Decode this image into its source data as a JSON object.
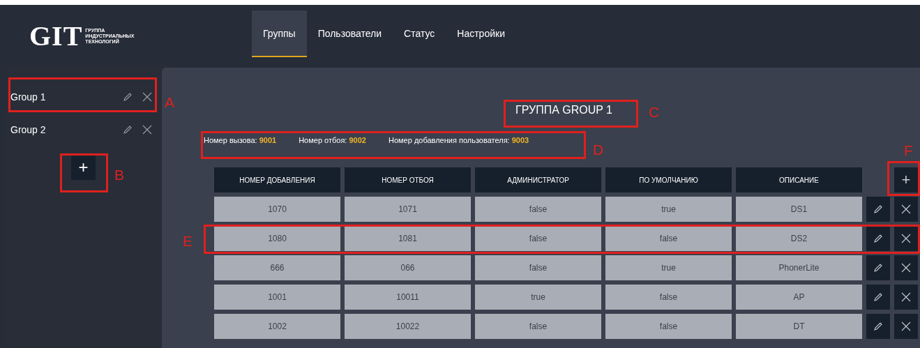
{
  "logo": {
    "mark": "GIT",
    "lines": [
      "ГРУППА",
      "ИНДУСТРИАЛЬНЫХ",
      "ТЕХНОЛОГИЙ"
    ]
  },
  "nav": [
    {
      "label": "Группы",
      "selected": true
    },
    {
      "label": "Пользователи",
      "selected": false
    },
    {
      "label": "Статус",
      "selected": false
    },
    {
      "label": "Настройки",
      "selected": false
    }
  ],
  "sidebar": {
    "groups": [
      {
        "name": "Group 1"
      },
      {
        "name": "Group 2"
      }
    ],
    "add_button": "+"
  },
  "panel": {
    "title": "ГРУППА GROUP 1",
    "info": [
      {
        "label": "Номер вызова:",
        "value": "9001"
      },
      {
        "label": "Номер отбоя:",
        "value": "9002"
      },
      {
        "label": "Номер добавления пользователя:",
        "value": "9003"
      }
    ],
    "table": {
      "columns": [
        "НОМЕР ДОБАВЛЕНИЯ",
        "НОМЕР ОТБОЯ",
        "АДМИНИСТРАТОР",
        "ПО УМОЛЧАНИЮ",
        "ОПИСАНИЕ"
      ],
      "add_button": "+",
      "rows": [
        [
          "1070",
          "1071",
          "false",
          "true",
          "DS1"
        ],
        [
          "1080",
          "1081",
          "false",
          "false",
          "DS2"
        ],
        [
          "666",
          "066",
          "false",
          "true",
          "PhonerLite"
        ],
        [
          "1001",
          "10011",
          "true",
          "false",
          "AP"
        ],
        [
          "1002",
          "10022",
          "false",
          "false",
          "DT"
        ]
      ]
    }
  },
  "annotations": [
    {
      "letter": "A"
    },
    {
      "letter": "B"
    },
    {
      "letter": "C"
    },
    {
      "letter": "D"
    },
    {
      "letter": "E"
    },
    {
      "letter": "F"
    }
  ]
}
